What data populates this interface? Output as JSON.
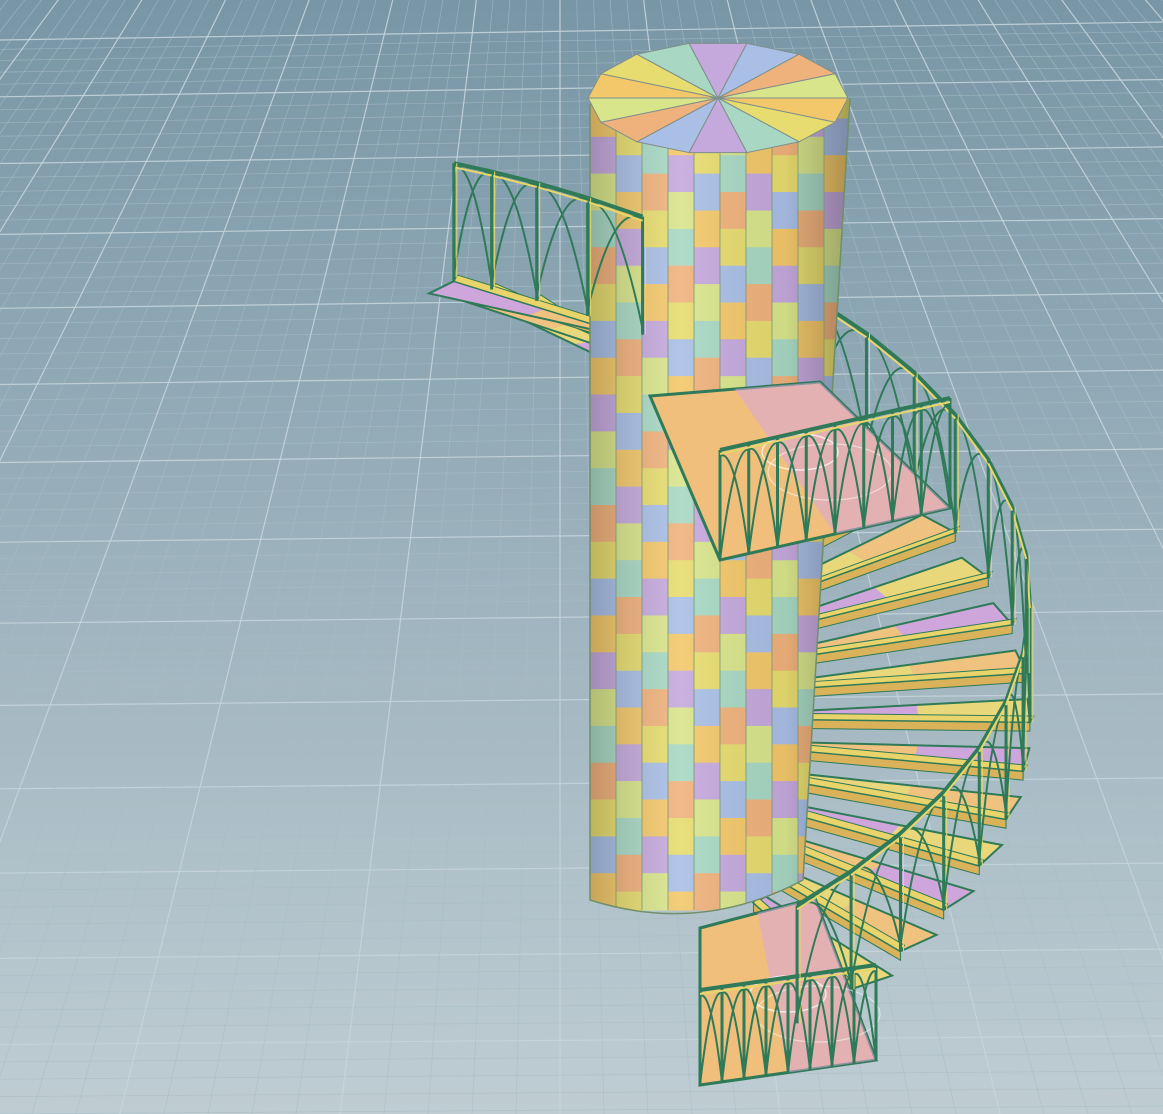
{
  "viewport": {
    "background_top": "#7896a6",
    "background_bottom": "#bfcdd3",
    "grid_minor_color": "#a9bcc6",
    "grid_major_color": "#c6d4db"
  },
  "model": {
    "frame_color": "#2f7a58",
    "checker_colors": [
      "#f3c86a",
      "#e7dc6f",
      "#a8d8c4",
      "#c5a9dd",
      "#a9bfe6",
      "#f0b27c",
      "#d9e58b"
    ],
    "tread_colors": [
      "#f0c27f",
      "#cfa6dc",
      "#e9d77c"
    ]
  }
}
